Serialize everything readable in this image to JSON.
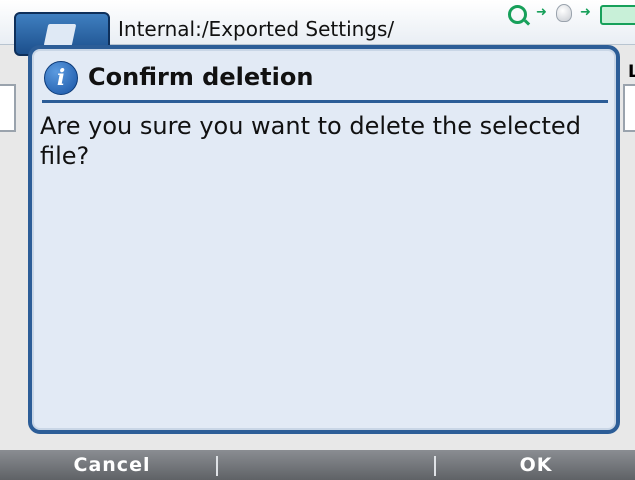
{
  "header": {
    "path": "Internal:/Exported Settings/",
    "status_icons": [
      "search-icon",
      "arrow-right-icon",
      "bulb-icon",
      "arrow-right-icon",
      "battery-icon"
    ],
    "right_edge_letter": "L"
  },
  "dialog": {
    "icon": "info-icon",
    "icon_glyph": "i",
    "title": "Confirm deletion",
    "message": "Are you sure you want to delete the selected file?"
  },
  "softkeys": {
    "left_label": "Cancel",
    "right_label": "OK"
  },
  "colors": {
    "accent": "#2c5d97",
    "dialog_bg": "#e2eaf5",
    "status_green": "#17a05a",
    "softkey_bar": "#6f7276"
  }
}
